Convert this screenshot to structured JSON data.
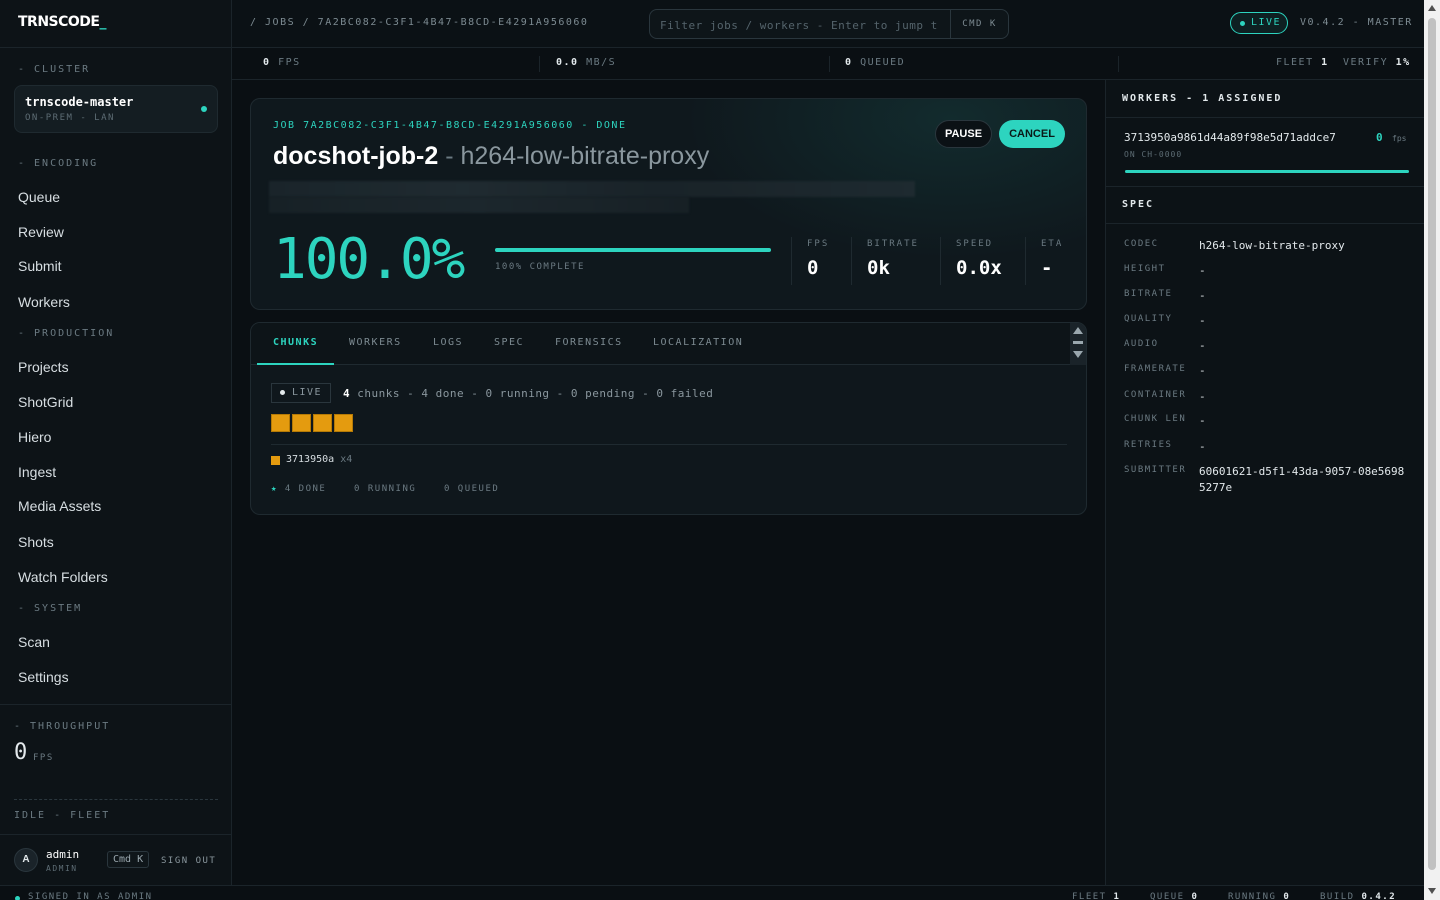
{
  "app": {
    "logo": "TRNSCODE",
    "logo_cursor": "_"
  },
  "sidebar": {
    "cluster_label": "- CLUSTER",
    "cluster_name": "trnscode-master",
    "cluster_sub": "ON-PREM - LAN",
    "sections": {
      "encoding": "- ENCODING",
      "production": "- PRODUCTION",
      "system": "- SYSTEM"
    },
    "encoding_items": [
      "Queue",
      "Review",
      "Submit",
      "Workers"
    ],
    "production_items": [
      "Projects",
      "ShotGrid",
      "Hiero",
      "Ingest",
      "Media Assets",
      "Shots",
      "Watch Folders"
    ],
    "system_items": [
      "Scan",
      "Settings"
    ],
    "throughput_label": "- THROUGHPUT",
    "throughput_value": "0",
    "throughput_unit": "FPS",
    "fleet_status": "IDLE - FLEET",
    "user": {
      "initial": "A",
      "name": "admin",
      "role": "ADMIN"
    },
    "cmd_k": "Cmd K",
    "sign_out": "SIGN OUT"
  },
  "topbar": {
    "breadcrumb": "/ JOBS / 7A2BC082-C3F1-4B47-B8CD-E4291A956060",
    "search_placeholder": "Filter jobs / workers - Enter to jump t",
    "search_shortcut": "CMD K",
    "live": "LIVE",
    "version": "V0.4.2 - MASTER"
  },
  "stats": {
    "fps_value": "0",
    "fps_label": "FPS",
    "mbps_value": "0.0",
    "mbps_label": "MB/S",
    "queued_value": "0",
    "queued_label": "QUEUED",
    "fleet_label": "FLEET",
    "fleet_value": "1",
    "verify_label": "VERIFY",
    "verify_value": "1%"
  },
  "job": {
    "id_line": "JOB 7A2BC082-C3F1-4B47-B8CD-E4291A956060 - DONE",
    "name": "docshot-job-2",
    "separator": " - ",
    "preset": "h264-low-bitrate-proxy",
    "pause": "PAUSE",
    "cancel": "CANCEL",
    "percent": "100.0%",
    "progress_fraction": 1.0,
    "progress_label": "100% COMPLETE",
    "metrics": [
      {
        "label": "FPS",
        "value": "0"
      },
      {
        "label": "BITRATE",
        "value": "0k"
      },
      {
        "label": "SPEED",
        "value": "0.0x"
      },
      {
        "label": "ETA",
        "value": "-"
      }
    ]
  },
  "tabs": [
    "CHUNKS",
    "WORKERS",
    "LOGS",
    "SPEC",
    "FORENSICS",
    "LOCALIZATION"
  ],
  "chunks": {
    "live": "LIVE",
    "total": "4",
    "summary": "chunks - 4 done - 0 running - 0 pending - 0 failed",
    "block_count": 4,
    "block_color": "#e49b0f",
    "worker_id": "3713950a",
    "worker_mult": "x4",
    "stats": "4 DONE    0 RUNNING    0 QUEUED"
  },
  "workers_panel": {
    "title": "WORKERS - 1 ASSIGNED",
    "worker_hash": "3713950a9861d44a89f98e5d71addce7",
    "worker_fps": "0",
    "worker_fps_unit": "fps",
    "worker_on": "ON CH-0000",
    "worker_progress": 1.0
  },
  "spec_panel": {
    "title": "SPEC",
    "rows": [
      {
        "key": "CODEC",
        "value": "h264-low-bitrate-proxy"
      },
      {
        "key": "HEIGHT",
        "value": "-"
      },
      {
        "key": "BITRATE",
        "value": "-"
      },
      {
        "key": "QUALITY",
        "value": "-"
      },
      {
        "key": "AUDIO",
        "value": "-"
      },
      {
        "key": "FRAMERATE",
        "value": "-"
      },
      {
        "key": "CONTAINER",
        "value": "-"
      },
      {
        "key": "CHUNK LEN",
        "value": "-"
      },
      {
        "key": "RETRIES",
        "value": "-"
      },
      {
        "key": "SUBMITTER",
        "value": "60601621-d5f1-43da-9057-08e56985277e"
      }
    ]
  },
  "statusbar": {
    "signed_in": "SIGNED IN AS ADMIN",
    "fleet_label": "FLEET",
    "fleet_value": "1",
    "queue_label": "QUEUE",
    "queue_value": "0",
    "running_label": "RUNNING",
    "running_value": "0",
    "build_label": "BUILD",
    "build_value": "0.4.2"
  },
  "colors": {
    "accent": "#2dd4bf",
    "chunk": "#e49b0f",
    "background": "#0a0f13"
  }
}
